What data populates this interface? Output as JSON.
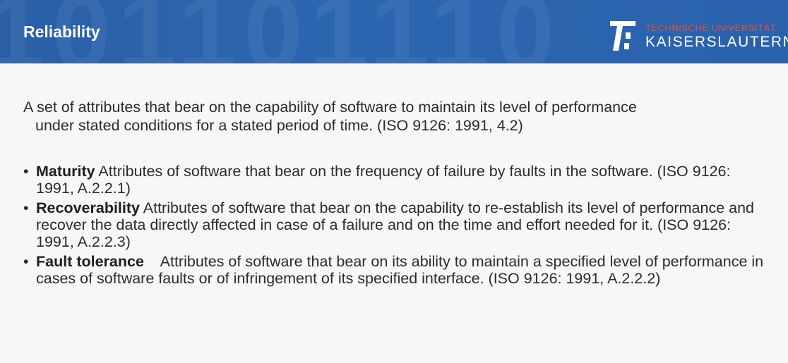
{
  "header": {
    "title": "Reliability",
    "logo": {
      "line1": "TECHNISCHE UNIVERSITÄT",
      "line2": "KAISERSLAUTERN"
    },
    "colors": {
      "background": "#2d66b0",
      "logo_accent": "#e2513f"
    }
  },
  "intro": {
    "line1": "A set of attributes that bear on the capability of software to maintain its level of performance",
    "line2": "under stated conditions for a stated period of time. (ISO 9126: 1991, 4.2)"
  },
  "bullets": [
    {
      "term": "Maturity",
      "text": " Attributes of software that bear on the frequency of failure by faults in the software. (ISO 9126: 1991, A.2.2.1)"
    },
    {
      "term": "Recoverability",
      "text": " Attributes of software that bear on the capability to re-establish its level of performance and recover the data directly affected in case of a failure and on the time and effort needed for it. (ISO 9126: 1991, A.2.2.3)"
    },
    {
      "term": "Fault tolerance",
      "text": "    Attributes of software that bear on its ability to maintain a specified level of performance in cases of software faults or of infringement of its specified interface. (ISO 9126: 1991, A.2.2.2)"
    }
  ]
}
